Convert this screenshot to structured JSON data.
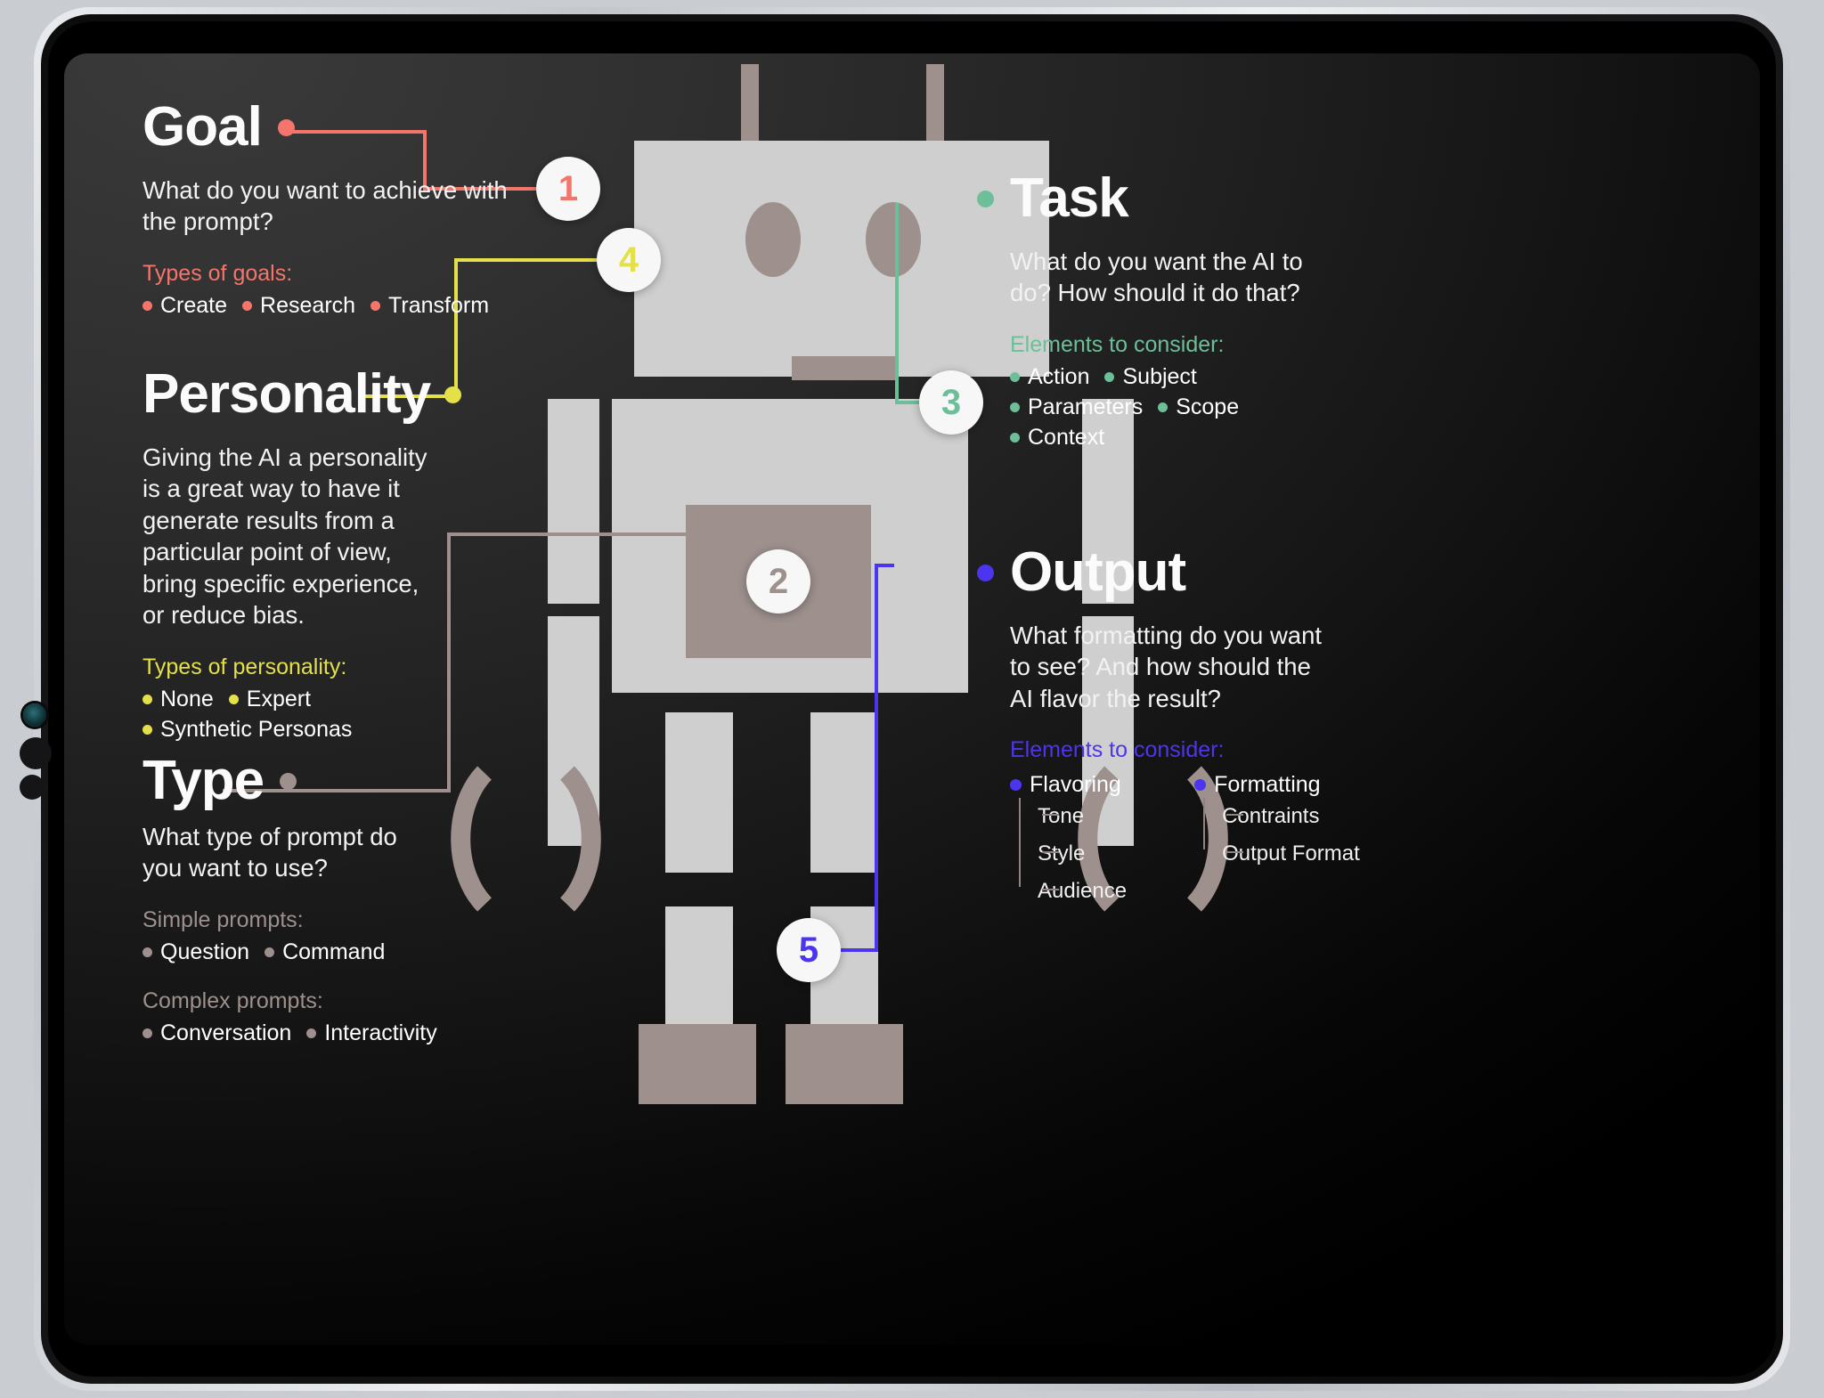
{
  "palette": {
    "goal": "#f4756b",
    "task": "#6cbf99",
    "personality": "#e4e04a",
    "type": "#9d908d",
    "output": "#4b35ef",
    "robot_light": "#cfcfcf",
    "robot_dark": "#9d908d",
    "screen_bg": "#1b1b1b"
  },
  "sections": {
    "goal": {
      "title": "Goal",
      "lede": "What do you want to achieve with the prompt?",
      "sub": "Types of goals:",
      "items": [
        "Create",
        "Research",
        "Transform"
      ]
    },
    "task": {
      "title": "Task",
      "lede": "What do you want the AI to do? How should it do that?",
      "sub": "Elements to consider:",
      "items": [
        "Action",
        "Subject",
        "Parameters",
        "Scope",
        "Context"
      ]
    },
    "personality": {
      "title": "Personality",
      "lede": "Giving the AI a personality is a great way to have it generate results from a particular point of view, bring specific experience, or reduce bias.",
      "sub": "Types of personality:",
      "items": [
        "None",
        "Expert",
        "Synthetic Personas"
      ]
    },
    "type": {
      "title": "Type",
      "lede": "What type of prompt do you want to use?",
      "sub_simple": "Simple prompts:",
      "items_simple": [
        "Question",
        "Command"
      ],
      "sub_complex": "Complex prompts:",
      "items_complex": [
        "Conversation",
        "Interactivity"
      ]
    },
    "output": {
      "title": "Output",
      "lede": "What formatting do you want to see? And how should the AI flavor the result?",
      "sub": "Elements to consider:",
      "trees": [
        {
          "label": "Flavoring",
          "children": [
            "Tone",
            "Style",
            "Audience"
          ]
        },
        {
          "label": "Formatting",
          "children": [
            "Contraints",
            "Output Format"
          ]
        }
      ]
    }
  },
  "badges": [
    {
      "num": "1",
      "color": "#f4756b"
    },
    {
      "num": "2",
      "color": "#9d908d"
    },
    {
      "num": "3",
      "color": "#6cbf99"
    },
    {
      "num": "4",
      "color": "#e4e04a"
    },
    {
      "num": "5",
      "color": "#4b35ef"
    }
  ]
}
